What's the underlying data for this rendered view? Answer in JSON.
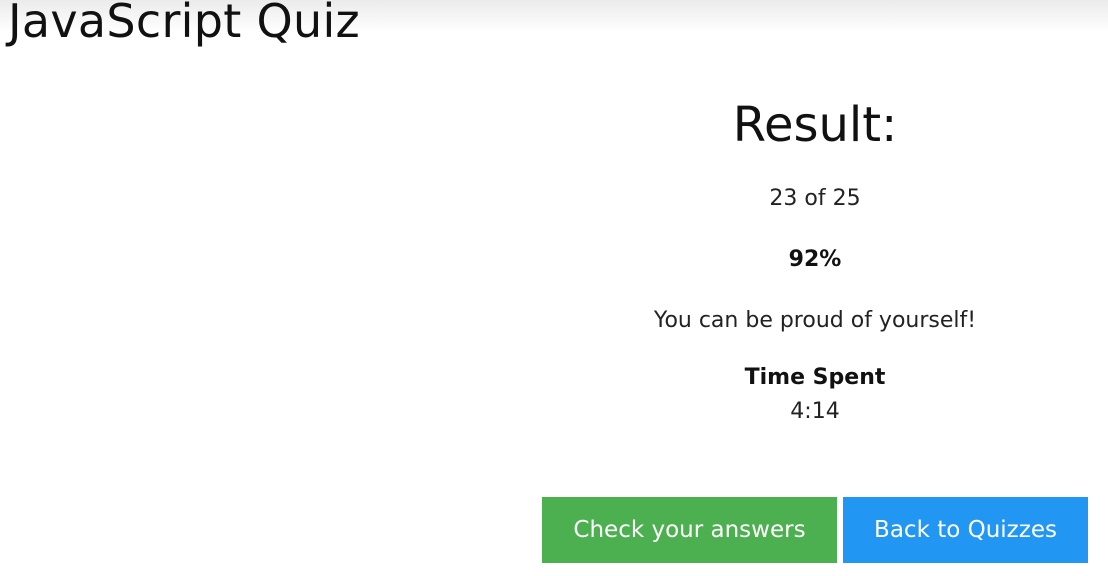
{
  "header": {
    "title": "JavaScript Quiz"
  },
  "result": {
    "heading": "Result:",
    "score": "23 of 25",
    "percent": "92%",
    "message": "You can be proud of yourself!",
    "time_label": "Time Spent",
    "time_value": "4:14"
  },
  "actions": {
    "check_label": "Check your answers",
    "back_label": "Back to Quizzes"
  },
  "colors": {
    "check_button": "#4caf50",
    "back_button": "#2196f3"
  }
}
